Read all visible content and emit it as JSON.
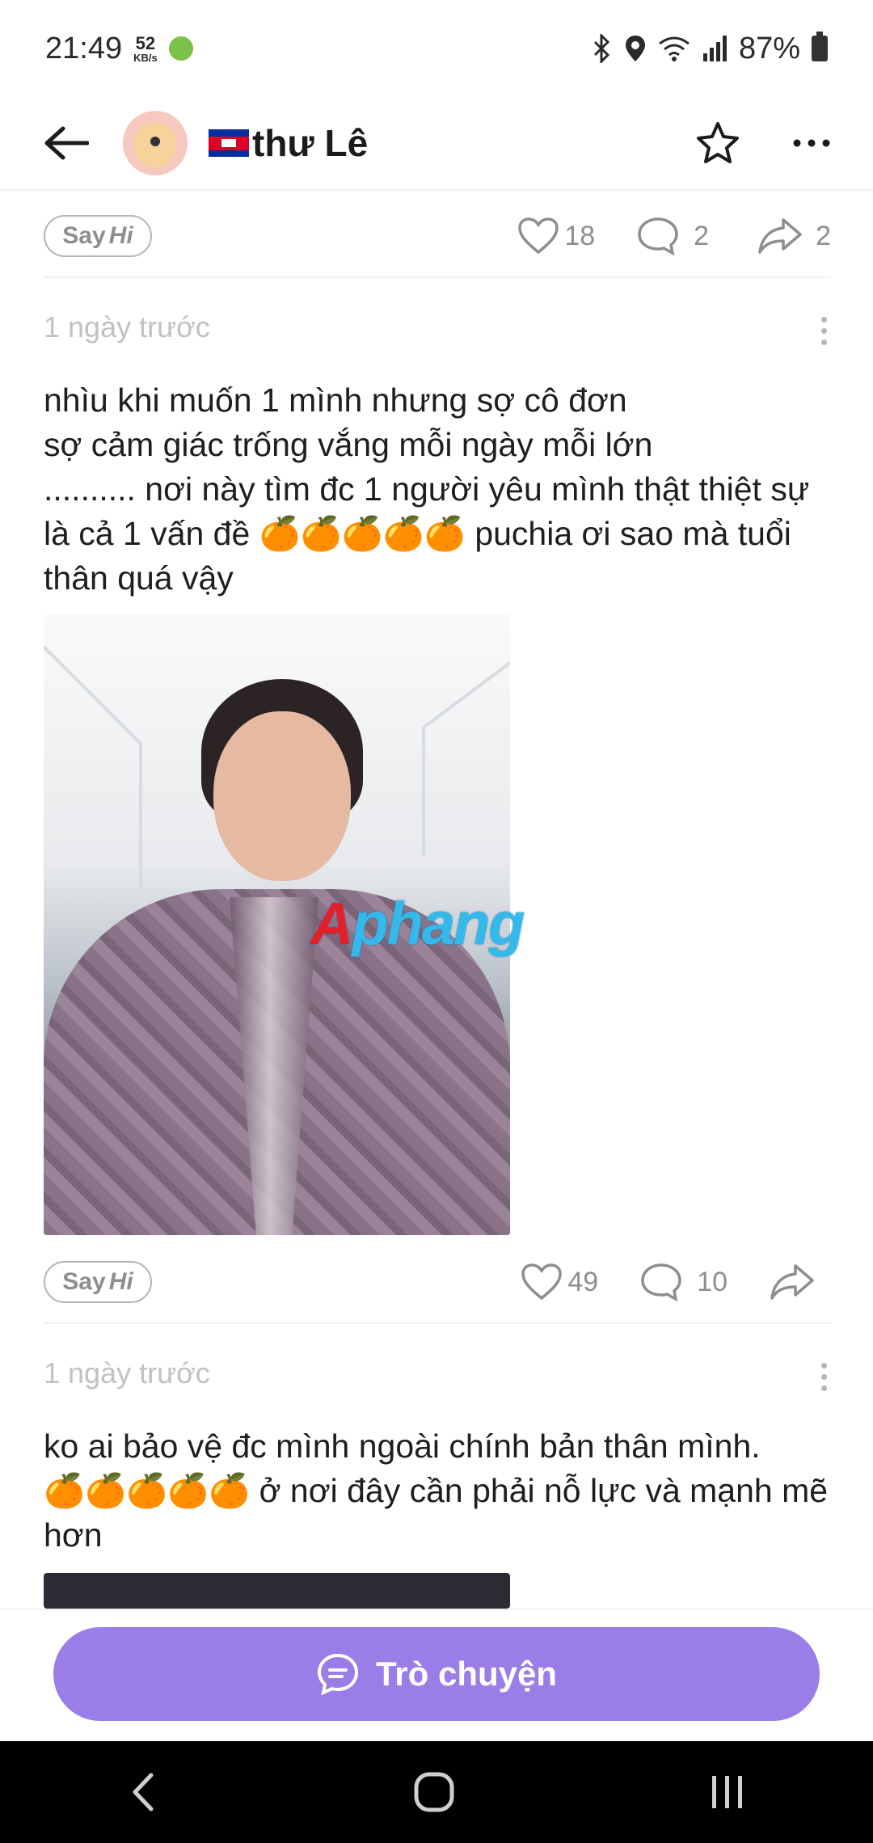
{
  "status_bar": {
    "time": "21:49",
    "net_speed": "52",
    "net_unit": "KB/s",
    "battery": "87%"
  },
  "header": {
    "username": "thư Lê"
  },
  "posts": [
    {
      "sayhi_prefix": "Say",
      "sayhi_suffix": "Hi",
      "likes": "18",
      "comments": "2",
      "shares": "2"
    },
    {
      "time": "1 ngày trước",
      "text": "nhìu khi muốn 1 mình nhưng sợ cô đơn\nsợ cảm giác trống vắng mỗi ngày mỗi lớn\n.......... nơi này tìm đc 1 người yêu mình thật thiệt sự là cả 1 vấn đề 🍊🍊🍊🍊🍊 puchia ơi sao mà tuổi thân quá vậy",
      "image_watermark_prefix": "A",
      "image_watermark_suffix": "phang",
      "sayhi_prefix": "Say",
      "sayhi_suffix": "Hi",
      "likes": "49",
      "comments": "10"
    },
    {
      "time": "1 ngày trước",
      "text": "ko ai bảo vệ đc mình ngoài chính bản thân mình.\n🍊🍊🍊🍊🍊 ở nơi đây cần phải nỗ lực và mạnh mẽ hơn"
    }
  ],
  "chat_button": {
    "label": "Trò chuyện"
  },
  "colors": {
    "accent": "#9b7de8",
    "muted": "#8e8e8e"
  }
}
